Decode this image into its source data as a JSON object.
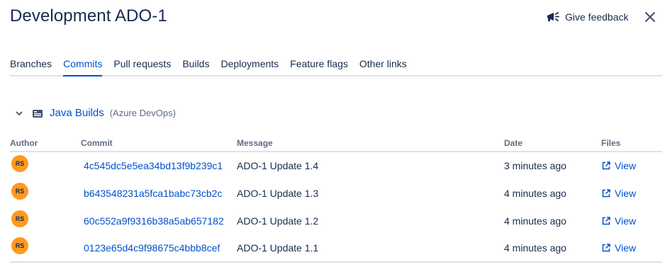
{
  "header": {
    "title": "Development ADO-1",
    "feedback_label": "Give feedback"
  },
  "tabs": [
    {
      "label": "Branches",
      "active": false
    },
    {
      "label": "Commits",
      "active": true
    },
    {
      "label": "Pull requests",
      "active": false
    },
    {
      "label": "Builds",
      "active": false
    },
    {
      "label": "Deployments",
      "active": false
    },
    {
      "label": "Feature flags",
      "active": false
    },
    {
      "label": "Other links",
      "active": false
    }
  ],
  "repository": {
    "name": "Java Builds",
    "host": "(Azure DevOps)"
  },
  "table": {
    "columns": [
      "Author",
      "Commit",
      "Message",
      "Date",
      "Files"
    ],
    "rows": [
      {
        "author": "RS",
        "commit": "4c545dc5e5ea34bd13f9b239c1",
        "message": "ADO-1 Update 1.4",
        "date": "3 minutes ago",
        "files": "View"
      },
      {
        "author": "RS",
        "commit": "b643548231a5fca1babc73cb2c",
        "message": "ADO-1 Update 1.3",
        "date": "4 minutes ago",
        "files": "View"
      },
      {
        "author": "RS",
        "commit": "60c552a9f9316b38a5ab657182",
        "message": "ADO-1 Update 1.2",
        "date": "4 minutes ago",
        "files": "View"
      },
      {
        "author": "RS",
        "commit": "0123e65d4c9f98675c4bbb8cef",
        "message": "ADO-1 Update 1.1",
        "date": "4 minutes ago",
        "files": "View"
      }
    ]
  },
  "colors": {
    "link": "#0052cc",
    "text": "#172b4d",
    "avatar": "#ff991f",
    "border": "#dfe1e6"
  }
}
